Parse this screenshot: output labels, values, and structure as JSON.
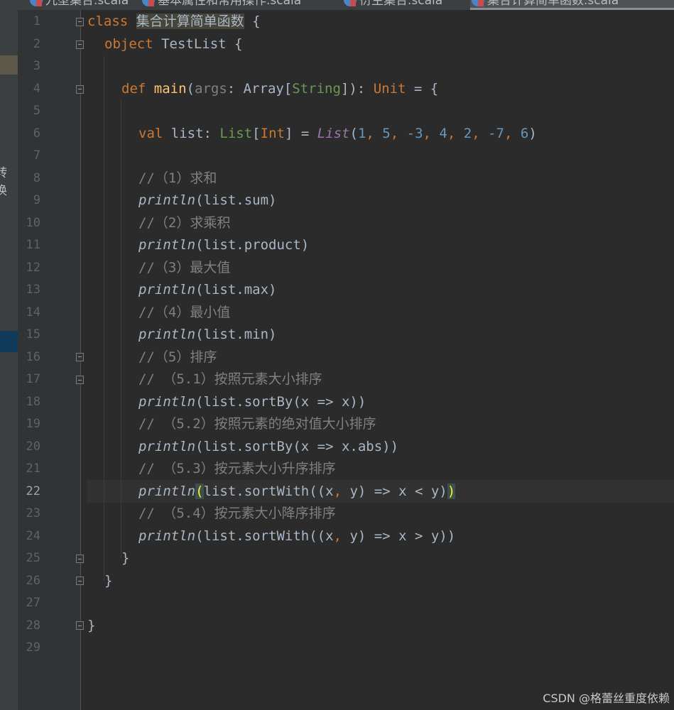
{
  "tabs": [
    {
      "label": "九型集合.scala"
    },
    {
      "label": "基本属性和常用操作.scala"
    },
    {
      "label": "衍生集合.scala"
    },
    {
      "label": "集合计算简单函数.scala"
    }
  ],
  "side_panel": {
    "cut_text": "转换"
  },
  "editor": {
    "current_line": 22,
    "line_numbers": [
      "1",
      "2",
      "3",
      "4",
      "5",
      "6",
      "7",
      "8",
      "9",
      "10",
      "11",
      "12",
      "13",
      "14",
      "15",
      "16",
      "17",
      "18",
      "19",
      "20",
      "21",
      "22",
      "23",
      "24",
      "25",
      "26",
      "27",
      "28",
      "29"
    ],
    "code": {
      "l1_kw": "class",
      "l1_name": "集合计算简单函数",
      "l1_brace": " {",
      "l2_kw": "object",
      "l2_rest": " TestList {",
      "l4_kw": "def",
      "l4_fn": "main",
      "l4_open": "(",
      "l4_param": "args",
      "l4_colon": ": Array[",
      "l4_type": "String",
      "l4_close": "]): ",
      "l4_unit": "Unit",
      "l4_tail": " = {",
      "l6_kw": "val",
      "l6_name": " list: ",
      "l6_type1": "List",
      "l6_br1": "[",
      "l6_type2": "Int",
      "l6_br2": "] = ",
      "l6_ctor": "List",
      "l6_open": "(",
      "l6_n1": "1",
      "l6_n2": "5",
      "l6_n3": "-3",
      "l6_n4": "4",
      "l6_n5": "2",
      "l6_n6": "-7",
      "l6_n7": "6",
      "l6_close": ")",
      "l8": "//（1）求和",
      "l9_fn": "println",
      "l9_rest": "(list.sum)",
      "l10": "//（2）求乘积",
      "l11_fn": "println",
      "l11_rest": "(list.product)",
      "l12": "//（3）最大值",
      "l13_fn": "println",
      "l13_rest": "(list.max)",
      "l14": "//（4）最小值",
      "l15_fn": "println",
      "l15_rest": "(list.min)",
      "l16": "//（5）排序",
      "l17": "// （5.1）按照元素大小排序",
      "l18_fn": "println",
      "l18_rest": "(list.sortBy(x => x))",
      "l19": "// （5.2）按照元素的绝对值大小排序",
      "l20_fn": "println",
      "l20_rest": "(list.sortBy(x => x.abs))",
      "l21": "// （5.3）按元素大小升序排序",
      "l22_fn": "println",
      "l22_open": "(",
      "l22_mid": "list.sortWith((x",
      "l22_comma": ",",
      "l22_rest": " y) => x < y)",
      "l22_close": ")",
      "l23": "// （5.4）按元素大小降序排序",
      "l24_fn": "println",
      "l24_mid": "(list.sortWith((x",
      "l24_comma": ",",
      "l24_rest": " y) => x > y))",
      "l25": "}",
      "l26": "}",
      "l28": "}"
    }
  },
  "watermark": "CSDN @格蕾丝重度依赖",
  "colors": {
    "background": "#2b2b2b",
    "keyword": "#cc7832",
    "function": "#ffc66d",
    "number": "#6897bb",
    "comment": "#808080",
    "text": "#a9b7c6"
  }
}
